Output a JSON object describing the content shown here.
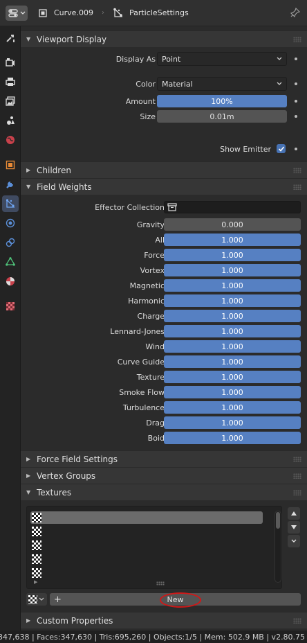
{
  "header": {
    "object_name": "Curve.009",
    "settings_name": "ParticleSettings"
  },
  "tabs": [
    "tool-icon",
    "render-icon",
    "output-icon",
    "view-layer-icon",
    "scene-icon",
    "world-icon",
    "object-icon",
    "modifier-icon",
    "particles-icon",
    "physics-icon",
    "constraints-icon",
    "object-data-icon",
    "material-icon",
    "texture-icon"
  ],
  "viewport_display": {
    "title": "Viewport Display",
    "display_as_label": "Display As",
    "display_as_value": "Point",
    "color_label": "Color",
    "color_value": "Material",
    "amount_label": "Amount",
    "amount_value": "100%",
    "amount_fraction": 1.0,
    "size_label": "Size",
    "size_value": "0.01m",
    "show_emitter_label": "Show Emitter",
    "show_emitter_checked": true
  },
  "children": {
    "title": "Children"
  },
  "field_weights": {
    "title": "Field Weights",
    "effector_label": "Effector Collection",
    "rows": [
      {
        "label": "Gravity",
        "value": "0.000"
      },
      {
        "label": "All",
        "value": "1.000"
      },
      {
        "label": "Force",
        "value": "1.000"
      },
      {
        "label": "Vortex",
        "value": "1.000"
      },
      {
        "label": "Magnetic",
        "value": "1.000"
      },
      {
        "label": "Harmonic",
        "value": "1.000"
      },
      {
        "label": "Charge",
        "value": "1.000"
      },
      {
        "label": "Lennard-Jones",
        "value": "1.000"
      },
      {
        "label": "Wind",
        "value": "1.000"
      },
      {
        "label": "Curve Guide",
        "value": "1.000"
      },
      {
        "label": "Texture",
        "value": "1.000"
      },
      {
        "label": "Smoke Flow",
        "value": "1.000"
      },
      {
        "label": "Turbulence",
        "value": "1.000"
      },
      {
        "label": "Drag",
        "value": "1.000"
      },
      {
        "label": "Boid",
        "value": "1.000"
      }
    ]
  },
  "force_field_settings": {
    "title": "Force Field Settings"
  },
  "vertex_groups": {
    "title": "Vertex Groups"
  },
  "textures": {
    "title": "Textures",
    "new_label": "New"
  },
  "custom_properties": {
    "title": "Custom Properties"
  },
  "status_bar": {
    "text": "347,638 | Faces:347,630 | Tris:695,260 | Objects:1/5 | Mem: 502.9 MB | v2.80.75"
  },
  "colors": {
    "accent_blue": "#5680c2",
    "highlight_red": "#d01818"
  }
}
